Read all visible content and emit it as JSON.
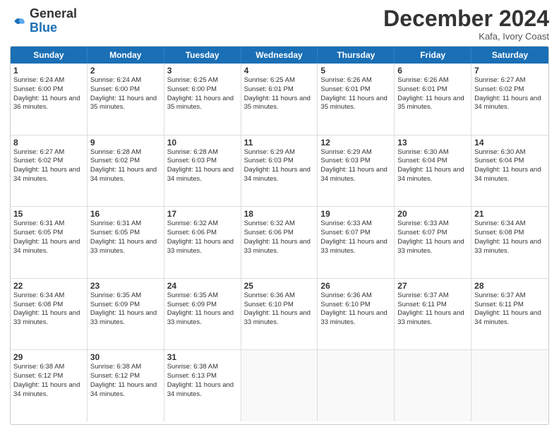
{
  "logo": {
    "general": "General",
    "blue": "Blue"
  },
  "header": {
    "month": "December 2024",
    "location": "Kafa, Ivory Coast"
  },
  "days": [
    "Sunday",
    "Monday",
    "Tuesday",
    "Wednesday",
    "Thursday",
    "Friday",
    "Saturday"
  ],
  "rows": [
    [
      {
        "day": 1,
        "sunrise": "6:24 AM",
        "sunset": "6:00 PM",
        "daylight": "11 hours and 36 minutes."
      },
      {
        "day": 2,
        "sunrise": "6:24 AM",
        "sunset": "6:00 PM",
        "daylight": "11 hours and 35 minutes."
      },
      {
        "day": 3,
        "sunrise": "6:25 AM",
        "sunset": "6:00 PM",
        "daylight": "11 hours and 35 minutes."
      },
      {
        "day": 4,
        "sunrise": "6:25 AM",
        "sunset": "6:01 PM",
        "daylight": "11 hours and 35 minutes."
      },
      {
        "day": 5,
        "sunrise": "6:26 AM",
        "sunset": "6:01 PM",
        "daylight": "11 hours and 35 minutes."
      },
      {
        "day": 6,
        "sunrise": "6:26 AM",
        "sunset": "6:01 PM",
        "daylight": "11 hours and 35 minutes."
      },
      {
        "day": 7,
        "sunrise": "6:27 AM",
        "sunset": "6:02 PM",
        "daylight": "11 hours and 34 minutes."
      }
    ],
    [
      {
        "day": 8,
        "sunrise": "6:27 AM",
        "sunset": "6:02 PM",
        "daylight": "11 hours and 34 minutes."
      },
      {
        "day": 9,
        "sunrise": "6:28 AM",
        "sunset": "6:02 PM",
        "daylight": "11 hours and 34 minutes."
      },
      {
        "day": 10,
        "sunrise": "6:28 AM",
        "sunset": "6:03 PM",
        "daylight": "11 hours and 34 minutes."
      },
      {
        "day": 11,
        "sunrise": "6:29 AM",
        "sunset": "6:03 PM",
        "daylight": "11 hours and 34 minutes."
      },
      {
        "day": 12,
        "sunrise": "6:29 AM",
        "sunset": "6:03 PM",
        "daylight": "11 hours and 34 minutes."
      },
      {
        "day": 13,
        "sunrise": "6:30 AM",
        "sunset": "6:04 PM",
        "daylight": "11 hours and 34 minutes."
      },
      {
        "day": 14,
        "sunrise": "6:30 AM",
        "sunset": "6:04 PM",
        "daylight": "11 hours and 34 minutes."
      }
    ],
    [
      {
        "day": 15,
        "sunrise": "6:31 AM",
        "sunset": "6:05 PM",
        "daylight": "11 hours and 34 minutes."
      },
      {
        "day": 16,
        "sunrise": "6:31 AM",
        "sunset": "6:05 PM",
        "daylight": "11 hours and 33 minutes."
      },
      {
        "day": 17,
        "sunrise": "6:32 AM",
        "sunset": "6:06 PM",
        "daylight": "11 hours and 33 minutes."
      },
      {
        "day": 18,
        "sunrise": "6:32 AM",
        "sunset": "6:06 PM",
        "daylight": "11 hours and 33 minutes."
      },
      {
        "day": 19,
        "sunrise": "6:33 AM",
        "sunset": "6:07 PM",
        "daylight": "11 hours and 33 minutes."
      },
      {
        "day": 20,
        "sunrise": "6:33 AM",
        "sunset": "6:07 PM",
        "daylight": "11 hours and 33 minutes."
      },
      {
        "day": 21,
        "sunrise": "6:34 AM",
        "sunset": "6:08 PM",
        "daylight": "11 hours and 33 minutes."
      }
    ],
    [
      {
        "day": 22,
        "sunrise": "6:34 AM",
        "sunset": "6:08 PM",
        "daylight": "11 hours and 33 minutes."
      },
      {
        "day": 23,
        "sunrise": "6:35 AM",
        "sunset": "6:09 PM",
        "daylight": "11 hours and 33 minutes."
      },
      {
        "day": 24,
        "sunrise": "6:35 AM",
        "sunset": "6:09 PM",
        "daylight": "11 hours and 33 minutes."
      },
      {
        "day": 25,
        "sunrise": "6:36 AM",
        "sunset": "6:10 PM",
        "daylight": "11 hours and 33 minutes."
      },
      {
        "day": 26,
        "sunrise": "6:36 AM",
        "sunset": "6:10 PM",
        "daylight": "11 hours and 33 minutes."
      },
      {
        "day": 27,
        "sunrise": "6:37 AM",
        "sunset": "6:11 PM",
        "daylight": "11 hours and 33 minutes."
      },
      {
        "day": 28,
        "sunrise": "6:37 AM",
        "sunset": "6:11 PM",
        "daylight": "11 hours and 34 minutes."
      }
    ],
    [
      {
        "day": 29,
        "sunrise": "6:38 AM",
        "sunset": "6:12 PM",
        "daylight": "11 hours and 34 minutes."
      },
      {
        "day": 30,
        "sunrise": "6:38 AM",
        "sunset": "6:12 PM",
        "daylight": "11 hours and 34 minutes."
      },
      {
        "day": 31,
        "sunrise": "6:38 AM",
        "sunset": "6:13 PM",
        "daylight": "11 hours and 34 minutes."
      },
      null,
      null,
      null,
      null
    ]
  ]
}
